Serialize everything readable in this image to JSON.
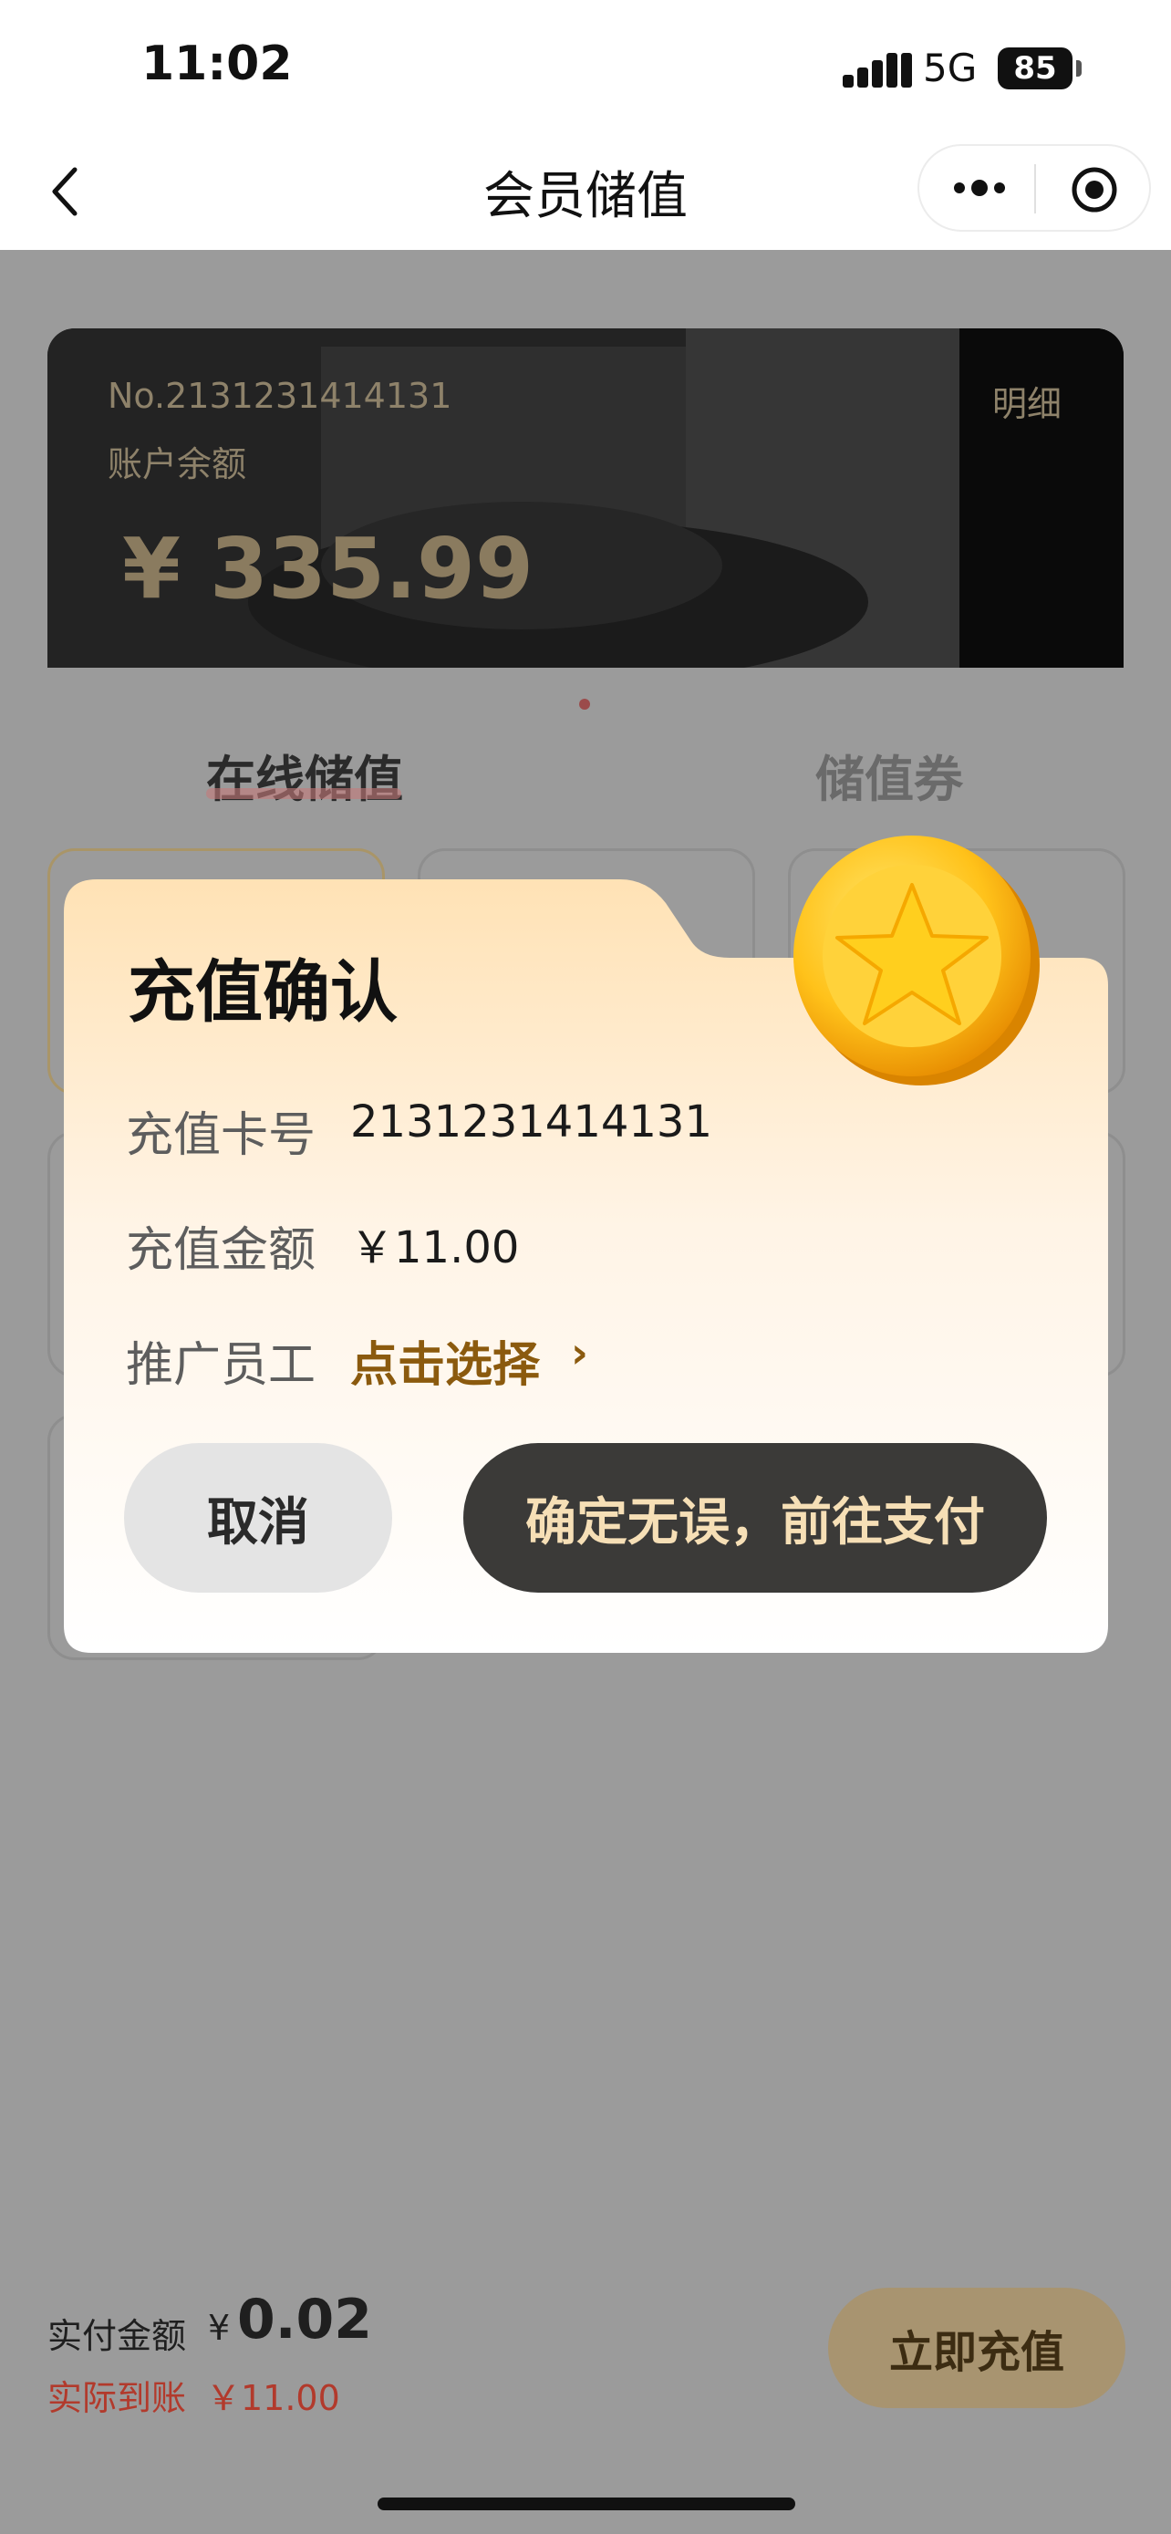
{
  "status_bar": {
    "time": "11:02",
    "network": "5G",
    "battery": "85"
  },
  "nav": {
    "title": "会员储值"
  },
  "card": {
    "number": "No.2131231414131",
    "balance_label": "账户余额",
    "detail_link": "明细",
    "balance": "¥ 335.99"
  },
  "tabs": [
    {
      "label": "在线储值",
      "active": true
    },
    {
      "label": "储值券",
      "active": false
    }
  ],
  "modal": {
    "title": "充值确认",
    "card_no_label": "充值卡号",
    "card_no_value": "2131231414131",
    "amount_label": "充值金额",
    "amount_value": "￥11.00",
    "staff_label": "推广员工",
    "staff_select": "点击选择",
    "staff_chevron": "›",
    "cancel": "取消",
    "confirm": "确定无误，前往支付"
  },
  "footer": {
    "pay_label": "实付金额",
    "pay_currency": "¥",
    "pay_amount": "0.02",
    "arrive_label": "实际到账",
    "arrive_amount": "￥11.00",
    "recharge_button": "立即充值"
  },
  "colors": {
    "overlay": "#9b9b9b",
    "gold_text": "#8b5a0e",
    "confirm_bg": "#3b3a38",
    "recharge_bg": "#a89470",
    "accent_red": "#b23a2c"
  },
  "icons": [
    "back-icon",
    "more-icon",
    "target-icon",
    "coin-icon",
    "signal-icon"
  ]
}
